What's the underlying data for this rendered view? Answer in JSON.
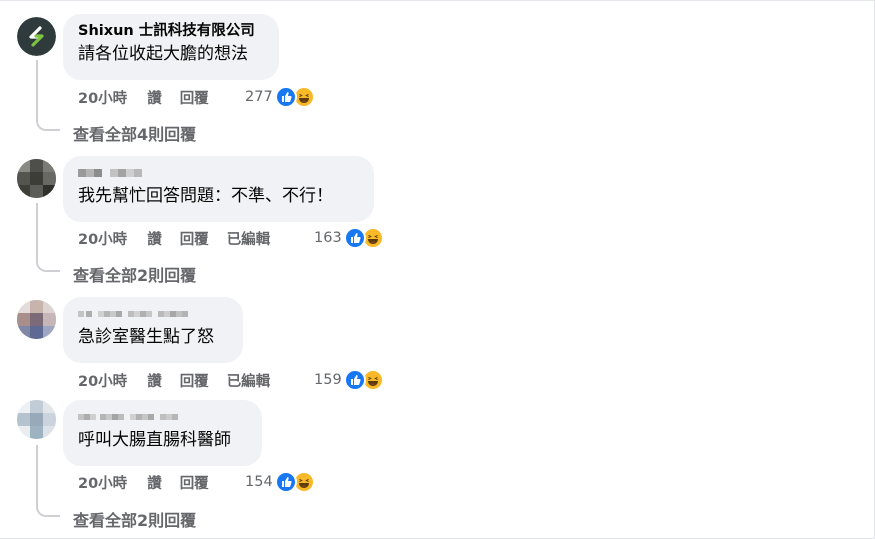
{
  "comments": [
    {
      "author": "Shixun 士訊科技有限公司",
      "author_visible": true,
      "text": "請各位收起大膽的想法",
      "time": "20小時",
      "like_label": "讚",
      "reply_label": "回覆",
      "edited_label": "",
      "reaction_count": "277",
      "view_replies": "查看全部4則回覆"
    },
    {
      "author": "",
      "author_visible": false,
      "text": "我先幫忙回答問題：不準、不行！",
      "time": "20小時",
      "like_label": "讚",
      "reply_label": "回覆",
      "edited_label": "已編輯",
      "reaction_count": "163",
      "view_replies": "查看全部2則回覆"
    },
    {
      "author": "",
      "author_visible": false,
      "text": "急診室醫生點了怒",
      "time": "20小時",
      "like_label": "讚",
      "reply_label": "回覆",
      "edited_label": "已編輯",
      "reaction_count": "159",
      "view_replies": ""
    },
    {
      "author": "",
      "author_visible": false,
      "text": "呼叫大腸直腸科醫師",
      "time": "20小時",
      "like_label": "讚",
      "reply_label": "回覆",
      "edited_label": "",
      "reaction_count": "154",
      "view_replies": "查看全部2則回覆"
    }
  ],
  "colors": {
    "bubble": "#f0f2f5",
    "secondary_text": "#65676b",
    "like_blue": "#1877f2",
    "haha_yellow": "#f7b928"
  },
  "icons": [
    "shixun-logo-icon",
    "like-reaction-icon",
    "haha-reaction-icon"
  ]
}
